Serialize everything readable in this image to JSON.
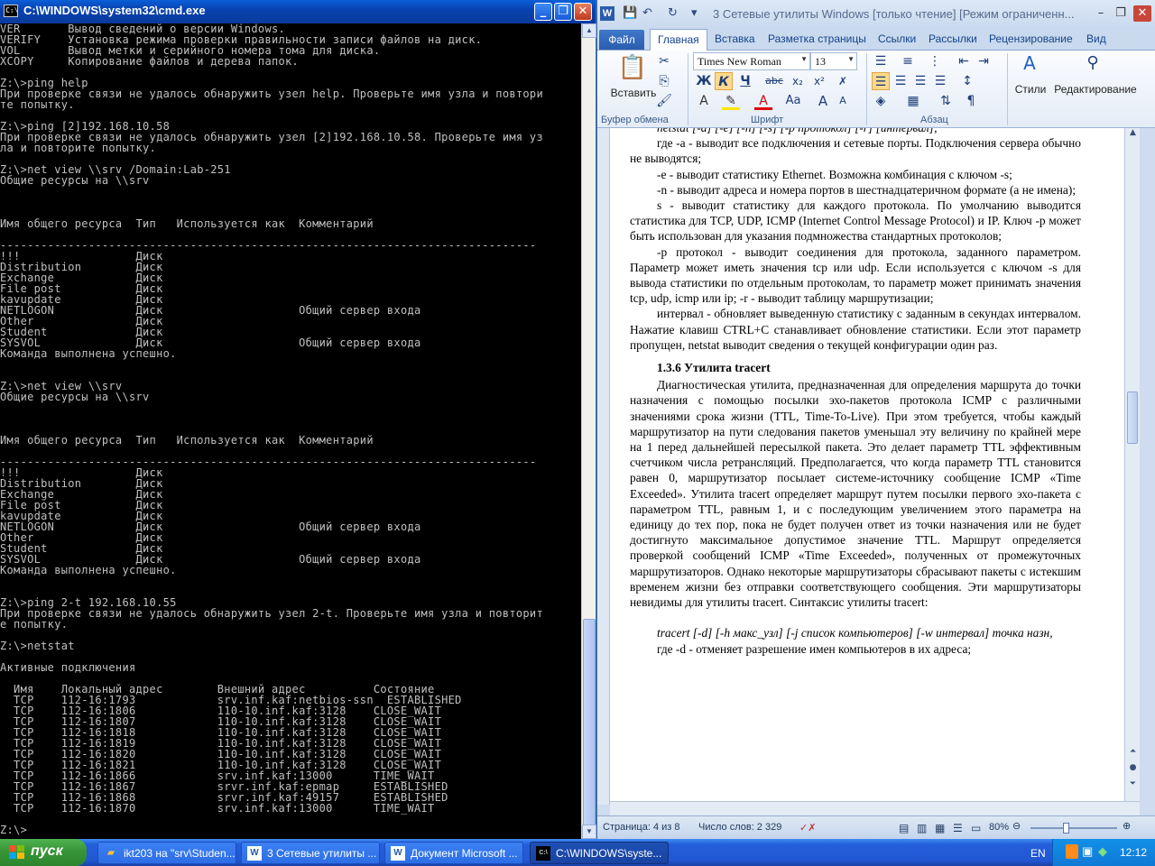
{
  "cmd": {
    "title": "C:\\WINDOWS\\system32\\cmd.exe",
    "icon": "cmd-icon",
    "buttons": {
      "minimize": "_",
      "maximize": "❐",
      "close": "✕"
    },
    "lines": [
      "VER       Вывод сведений о версии Windows.",
      "VERIFY    Установка режима проверки правильности записи файлов на диск.",
      "VOL       Вывод метки и серийного номера тома для диска.",
      "XCOPY     Копирование файлов и дерева папок.",
      "",
      "Z:\\>ping help",
      "При проверке связи не удалось обнаружить узел help. Проверьте имя узла и повтори",
      "те попытку.",
      "",
      "Z:\\>ping [2]192.168.10.58",
      "При проверке связи не удалось обнаружить узел [2]192.168.10.58. Проверьте имя уз",
      "ла и повторите попытку.",
      "",
      "Z:\\>net view \\\\srv /Domain:Lab-251",
      "Общие ресурсы на \\\\srv",
      "",
      "",
      "",
      "Имя общего ресурса  Тип   Используется как  Комментарий",
      "",
      "-------------------------------------------------------------------------------",
      "!!!                 Диск",
      "Distribution        Диск",
      "Exchange            Диск",
      "File post           Диск",
      "kavupdate           Диск",
      "NETLOGON            Диск                    Общий сервер входа",
      "Other               Диск",
      "Student             Диск",
      "SYSVOL              Диск                    Общий сервер входа",
      "Команда выполнена успешно.",
      "",
      "",
      "Z:\\>net view \\\\srv",
      "Общие ресурсы на \\\\srv",
      "",
      "",
      "",
      "Имя общего ресурса  Тип   Используется как  Комментарий",
      "",
      "-------------------------------------------------------------------------------",
      "!!!                 Диск",
      "Distribution        Диск",
      "Exchange            Диск",
      "File post           Диск",
      "kavupdate           Диск",
      "NETLOGON            Диск                    Общий сервер входа",
      "Other               Диск",
      "Student             Диск",
      "SYSVOL              Диск                    Общий сервер входа",
      "Команда выполнена успешно.",
      "",
      "",
      "Z:\\>ping 2-t 192.168.10.55",
      "При проверке связи не удалось обнаружить узел 2-t. Проверьте имя узла и повторит",
      "е попытку.",
      "",
      "Z:\\>netstat",
      "",
      "Активные подключения",
      "",
      "  Имя    Локальный адрес        Внешний адрес          Состояние",
      "  TCP    112-16:1793            srv.inf.kaf:netbios-ssn  ESTABLISHED",
      "  TCP    112-16:1806            110-10.inf.kaf:3128    CLOSE_WAIT",
      "  TCP    112-16:1807            110-10.inf.kaf:3128    CLOSE_WAIT",
      "  TCP    112-16:1818            110-10.inf.kaf:3128    CLOSE_WAIT",
      "  TCP    112-16:1819            110-10.inf.kaf:3128    CLOSE_WAIT",
      "  TCP    112-16:1820            110-10.inf.kaf:3128    CLOSE_WAIT",
      "  TCP    112-16:1821            110-10.inf.kaf:3128    CLOSE_WAIT",
      "  TCP    112-16:1866            srv.inf.kaf:13000      TIME_WAIT",
      "  TCP    112-16:1867            srvr.inf.kaf:epmap     ESTABLISHED",
      "  TCP    112-16:1868            srvr.inf.kaf:49157     ESTABLISHED",
      "  TCP    112-16:1870            srv.inf.kaf:13000      TIME_WAIT",
      "",
      "Z:\\>"
    ]
  },
  "word": {
    "title": "3 Сетевые утилиты Windows [только чтение] [Режим ограниченн...",
    "window_buttons": {
      "minimize": "–",
      "maximize": "❐",
      "close": "✕"
    },
    "tabs": [
      "Файл",
      "Главная",
      "Вставка",
      "Разметка страницы",
      "Ссылки",
      "Рассылки",
      "Рецензирование",
      "Вид"
    ],
    "ribbon": {
      "paste": "Вставить",
      "clipboard": "Буфер обмена",
      "font_name": "Times New Roman",
      "font_size": "13",
      "font_group": "Шрифт",
      "paragraph_group": "Абзац",
      "styles": "Стили",
      "editing": "Редактирование",
      "bold": "Ж",
      "italic": "К",
      "underline": "Ч",
      "strike": "abc",
      "subscript": "x₂",
      "superscript": "x²",
      "grow": "A",
      "shrink": "A",
      "case": "Aa"
    },
    "doc": {
      "top_line": "netstat [-a] [-e] [-n] [-s] [-p протокол] [-r] [интервал];",
      "paras": [
        "где -a - выводит все подключения и сетевые порты. Подключения сервера обычно не выводятся;",
        "-e - выводит статистику Ethernet. Возможна комбинация с ключом -s;",
        " -n - выводит адреса и номера портов в шестнадцатеричном формате (а не имена);",
        "s - выводит статистику для каждого протокола. По умолчанию выводится статистика для TCP, UDP, ICMP (Internet Control Message Protocol) и IP. Ключ -p может быть использован для указания подмножества стандартных протоколов;",
        "-p протокол - выводит соединения для протокола, заданного параметром. Параметр может иметь значения tcp или udp. Если используется с ключом -s для вывода статистики по отдельным протоколам, то параметр может принимать значения tcp, udp, icmp или ip; -r - выводит таблицу маршрутизации;",
        "интервал - обновляет выведенную статистику с заданным в секундах интервалом. Нажатие клавиш CTRL+C станавливает обновление статистики. Если этот параметр пропущен, netstat выводит сведения о текущей конфигурации один раз."
      ],
      "heading": "1.3.6 Утилита tracert",
      "tracert_para": "Диагностическая утилита, предназначенная для определения маршрута до точки назначения с помощью посылки эхо-пакетов протокола ICMP с различными значениями срока жизни (TTL, Time-To-Live). При этом требуется, чтобы каждый маршрутизатор на пути следования пакетов уменьшал эту величину по крайней мере на 1 перед дальнейшей пересылкой пакета. Это делает параметр TTL эффективным счетчиком числа ретрансляций. Предполагается, что когда параметр TTL становится равен 0, маршрутизатор посылает системе-источнику сообщение ICMP «Time Exceeded». Утилита tracert определяет маршрут путем посылки первого эхо-пакета с параметром TTL, равным 1, и с последующим увеличением этого параметра на единицу до тех пор, пока не будет получен ответ из точки назначения или не будет достигнуто максимальное допустимое значение TTL. Маршрут определяется проверкой сообщений ICMP «Time Exceeded», полученных от промежуточных маршрутизаторов. Однако некоторые маршрутизаторы сбрасывают пакеты с истекшим временем жизни без отправки соответствующего сообщения. Эти маршрутизаторы невидимы для утилиты tracert. Синтаксис утилиты tracert:",
      "syntax": "tracert [-d] [-h макс_узл] [-j список компьютеров] [-w интервал] точка назн,",
      "last": "где -d - отменяет разрешение имен компьютеров в их адреса;"
    },
    "status": {
      "page": "Страница: 4 из 8",
      "words": "Число слов: 2 329",
      "zoom": "80%",
      "zoom_level": 0.8
    }
  },
  "taskbar": {
    "start": "пуск",
    "items": [
      {
        "label": "ikt203 на \"srv\\Studen...",
        "icon": "folder-icon"
      },
      {
        "label": "3 Сетевые утилиты ...",
        "icon": "word-icon"
      },
      {
        "label": "Документ Microsoft ...",
        "icon": "word-icon"
      },
      {
        "label": "C:\\WINDOWS\\syste...",
        "icon": "cmd-icon"
      }
    ],
    "lang": "EN",
    "time": "12:12"
  }
}
